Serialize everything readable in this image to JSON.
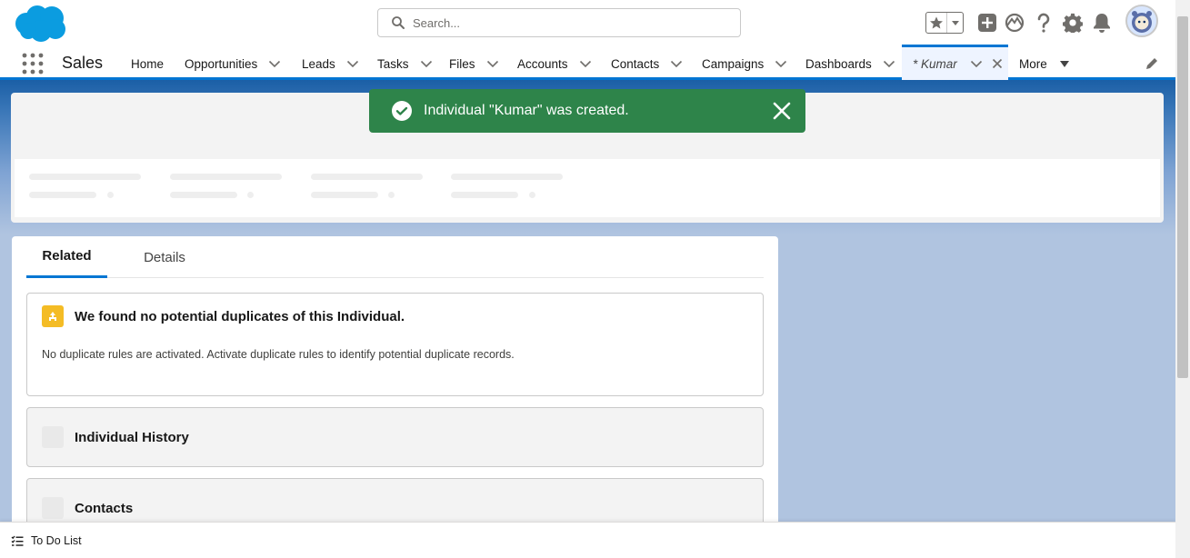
{
  "header": {
    "search_placeholder": "Search...",
    "icons": [
      "salesforce-cloud-logo",
      "search-icon",
      "star-icon",
      "chevron-down-icon",
      "add-icon",
      "trailhead-icon",
      "help-icon",
      "gear-icon",
      "bell-icon",
      "avatar"
    ]
  },
  "nav": {
    "app_name": "Sales",
    "items": [
      {
        "label": "Home"
      },
      {
        "label": "Opportunities"
      },
      {
        "label": "Leads"
      },
      {
        "label": "Tasks"
      },
      {
        "label": "Files"
      },
      {
        "label": "Accounts"
      },
      {
        "label": "Contacts"
      },
      {
        "label": "Campaigns"
      },
      {
        "label": "Dashboards"
      }
    ],
    "active_tab": "* Kumar",
    "more": "More"
  },
  "toast": {
    "message": "Individual \"Kumar\" was created."
  },
  "tabs": {
    "related": "Related",
    "details": "Details"
  },
  "duplicates": {
    "title": "We found no potential duplicates of this Individual.",
    "text": "No duplicate rules are activated. Activate duplicate rules to identify potential duplicate records."
  },
  "related_lists": [
    {
      "title": "Individual History"
    },
    {
      "title": "Contacts"
    }
  ],
  "utility": {
    "todo_label": "To Do List"
  },
  "colors": {
    "brand_blue": "#0176d3",
    "toast_green": "#2e844a",
    "duplicate_icon_yellow": "#f4bc25"
  }
}
